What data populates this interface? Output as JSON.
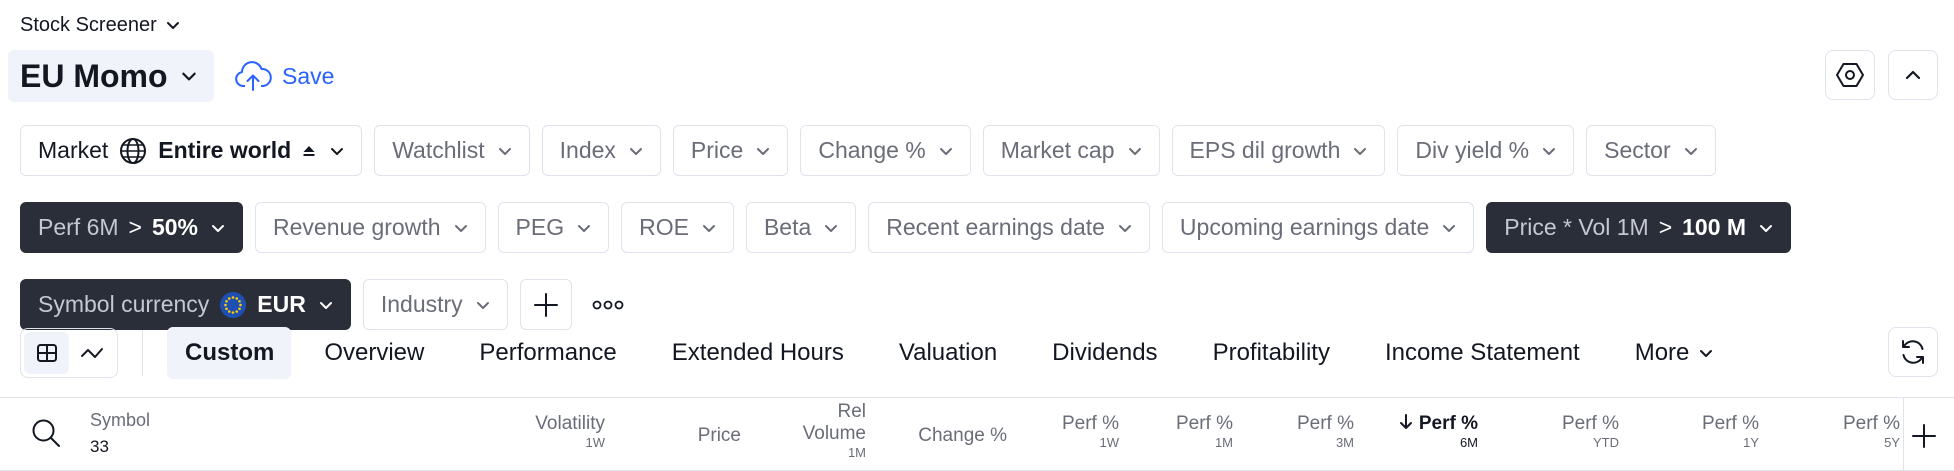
{
  "header": {
    "screener_menu": "Stock Screener",
    "screen_name": "EU Momo",
    "save_label": "Save"
  },
  "filters": {
    "market": {
      "label": "Market",
      "value": "Entire world"
    },
    "watchlist": "Watchlist",
    "index": "Index",
    "price": "Price",
    "change_pct": "Change %",
    "market_cap": "Market cap",
    "eps_growth": "EPS dil growth",
    "div_yield": "Div yield %",
    "sector": "Sector",
    "perf_6m": {
      "label": "Perf 6M",
      "op": ">",
      "value": "50%"
    },
    "revenue_growth": "Revenue growth",
    "peg": "PEG",
    "roe": "ROE",
    "beta": "Beta",
    "recent_earnings": "Recent earnings date",
    "upcoming_earnings": "Upcoming earnings date",
    "price_vol": {
      "label": "Price * Vol 1M",
      "op": ">",
      "value": "100 M"
    },
    "symbol_currency": {
      "label": "Symbol currency",
      "value": "EUR"
    },
    "industry": "Industry"
  },
  "tabs": [
    {
      "label": "Custom"
    },
    {
      "label": "Overview"
    },
    {
      "label": "Performance"
    },
    {
      "label": "Extended Hours"
    },
    {
      "label": "Valuation"
    },
    {
      "label": "Dividends"
    },
    {
      "label": "Profitability"
    },
    {
      "label": "Income Statement"
    },
    {
      "label": "More"
    }
  ],
  "table": {
    "symbol_header": "Symbol",
    "symbol_count": "33",
    "columns": [
      {
        "title": "Volatility",
        "sub": "1W"
      },
      {
        "title": "Price",
        "sub": ""
      },
      {
        "title": "Rel",
        "title2": "Volume",
        "sub": "1M"
      },
      {
        "title": "Change %",
        "sub": ""
      },
      {
        "title": "Perf %",
        "sub": "1W"
      },
      {
        "title": "Perf %",
        "sub": "1M"
      },
      {
        "title": "Perf %",
        "sub": "3M"
      },
      {
        "title": "Perf %",
        "sub": "6M",
        "sorted": "desc"
      },
      {
        "title": "Perf %",
        "sub": "YTD"
      },
      {
        "title": "Perf %",
        "sub": "1Y"
      },
      {
        "title": "Perf %",
        "sub": "5Y"
      }
    ]
  },
  "colors": {
    "accent": "#2962ff",
    "active_chip_bg": "#2a2e39",
    "border": "#e0e3eb",
    "text": "#131722",
    "muted": "#6a6d78",
    "selected_bg": "#f0f3fa",
    "euro_flag": "#1e4fb3"
  }
}
